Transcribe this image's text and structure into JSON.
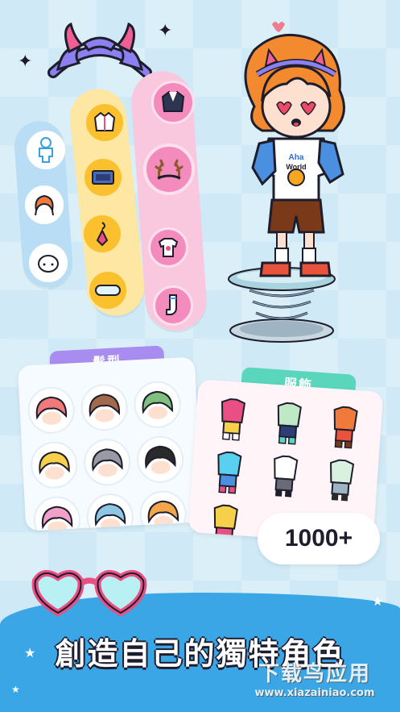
{
  "panels": {
    "hair_title": "髮型",
    "clothing_title": "服飾"
  },
  "badge": {
    "count_label": "1000+"
  },
  "headline": {
    "text": "創造自己的獨特角色"
  },
  "watermark": {
    "title": "下载鸟应用",
    "url": "www.xiazainiao.com"
  },
  "colors": {
    "accent_purple": "#a98cef",
    "accent_teal": "#59d6bb",
    "bottom_blue": "#3aa6e6",
    "pink_pill": "#f9c7de",
    "yellow_pill": "#fde7a3",
    "blue_pill": "#b9ddf5"
  },
  "category_icons": {
    "blue_column": [
      "body-icon",
      "hair-icon",
      "face-icon"
    ],
    "yellow_column": [
      "jacket-icon",
      "sofa-icon",
      "earring-icon",
      "glasses-icon"
    ],
    "pink_column": [
      "cardigan-icon",
      "antlers-icon",
      "tshirt-icon",
      "sock-icon"
    ]
  }
}
